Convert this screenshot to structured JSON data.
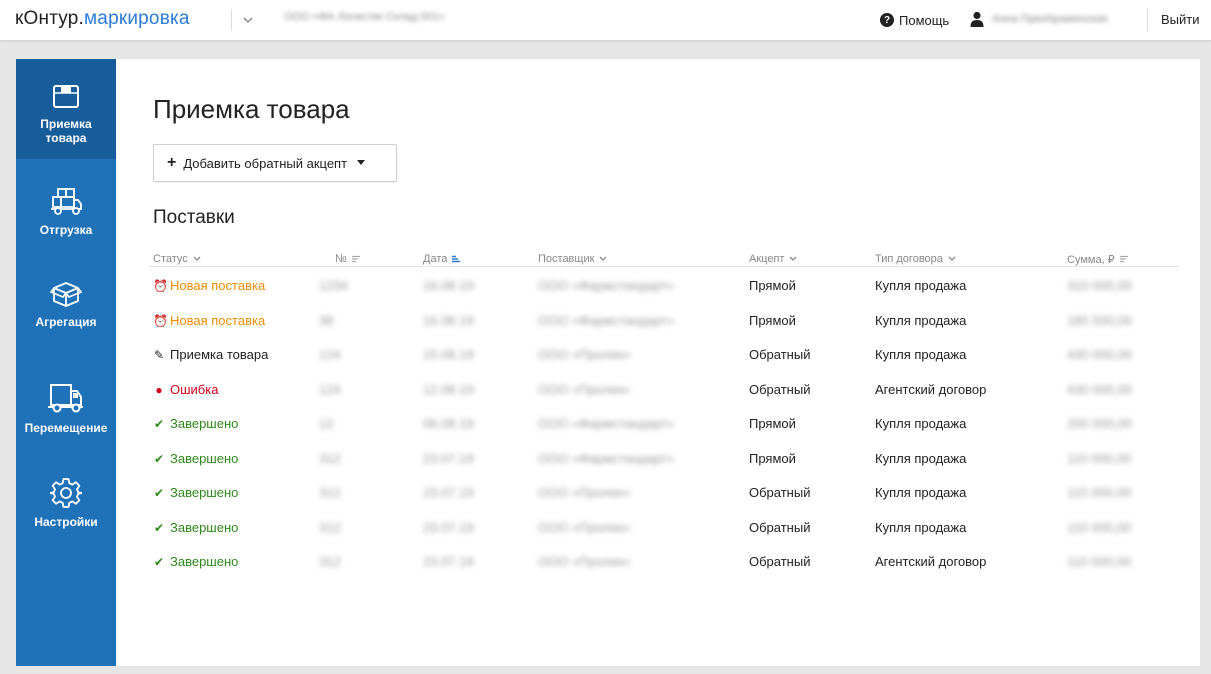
{
  "topbar": {
    "logo_dark": "к",
    "logo_o": "О",
    "logo_rest": "нтур.",
    "logo_accent": "маркировка",
    "org_name": "ООО «ФА Логистик Склад 001»",
    "help_label": "Помощь",
    "user_name": "Анна Преображенская",
    "logout_label": "Выйти"
  },
  "sidebar": {
    "items": [
      {
        "label": "Приемка\nтовара",
        "icon": "box-open-icon",
        "active": true
      },
      {
        "label": "Отгрузка",
        "icon": "truck-loaded-icon",
        "active": false
      },
      {
        "label": "Агрегация",
        "icon": "package-icon",
        "active": false
      },
      {
        "label": "Перемещение",
        "icon": "truck-icon",
        "active": false
      },
      {
        "label": "Настройки",
        "icon": "gear-icon",
        "active": false
      }
    ]
  },
  "main": {
    "title": "Приемка товара",
    "add_button": {
      "plus": "+",
      "label": "Добавить обратный акцепт"
    },
    "section_title": "Поставки",
    "columns": [
      {
        "label": "Статус",
        "sort": "dropdown"
      },
      {
        "label": "№",
        "sort": "sortable"
      },
      {
        "label": "Дата",
        "sort": "active"
      },
      {
        "label": "Поставщик",
        "sort": "dropdown"
      },
      {
        "label": "Акцепт",
        "sort": "dropdown"
      },
      {
        "label": "Тип договора",
        "sort": "dropdown"
      },
      {
        "label": "Сумма, ₽",
        "sort": "sortable"
      }
    ],
    "rows": [
      {
        "status": "Новая поставка",
        "status_type": "new",
        "number": "1234",
        "date": "16.08.19",
        "supplier": "ООО «Фармстандарт»",
        "accept": "Прямой",
        "contract": "Купля продажа",
        "sum": "310 000,00"
      },
      {
        "status": "Новая поставка",
        "status_type": "new",
        "number": "38",
        "date": "16.08.19",
        "supplier": "ООО «Фармстандарт»",
        "accept": "Прямой",
        "contract": "Купля продажа",
        "sum": "185 500,00"
      },
      {
        "status": "Приемка товара",
        "status_type": "progress",
        "number": "124",
        "date": "15.08.19",
        "supplier": "ООО «Пролек»",
        "accept": "Обратный",
        "contract": "Купля продажа",
        "sum": "430 000,00"
      },
      {
        "status": "Ошибка",
        "status_type": "error",
        "number": "124",
        "date": "12.08.19",
        "supplier": "ООО «Пролек»",
        "accept": "Обратный",
        "contract": "Агентский договор",
        "sum": "430 000,00"
      },
      {
        "status": "Завершено",
        "status_type": "done",
        "number": "12",
        "date": "06.08.19",
        "supplier": "ООО «Фармстандарт»",
        "accept": "Прямой",
        "contract": "Купля продажа",
        "sum": "200 000,00"
      },
      {
        "status": "Завершено",
        "status_type": "done",
        "number": "312",
        "date": "23.07.19",
        "supplier": "ООО «Фармстандарт»",
        "accept": "Прямой",
        "contract": "Купля продажа",
        "sum": "110 000,00"
      },
      {
        "status": "Завершено",
        "status_type": "done",
        "number": "312",
        "date": "23.07.19",
        "supplier": "ООО «Пролек»",
        "accept": "Обратный",
        "contract": "Купля продажа",
        "sum": "115 000,00"
      },
      {
        "status": "Завершено",
        "status_type": "done",
        "number": "312",
        "date": "23.07.19",
        "supplier": "ООО «Пролек»",
        "accept": "Обратный",
        "contract": "Купля продажа",
        "sum": "110 000,00"
      },
      {
        "status": "Завершено",
        "status_type": "done",
        "number": "312",
        "date": "23.07.19",
        "supplier": "ООО «Пролек»",
        "accept": "Обратный",
        "contract": "Агентский договор",
        "sum": "110 000,00"
      }
    ]
  },
  "colors": {
    "brand_blue": "#2b7bd6",
    "sidebar": "#1f71b8",
    "sidebar_active": "#175d9b",
    "status_new": "#f08c00",
    "status_progress": "#222222",
    "status_error": "#d0021b",
    "status_done": "#2e8b1a"
  }
}
